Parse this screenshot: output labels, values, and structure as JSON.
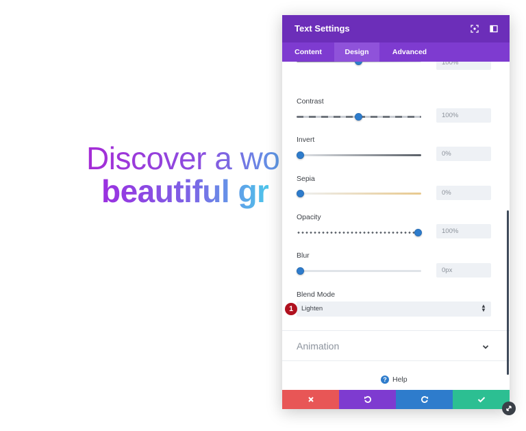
{
  "hero": {
    "line1": "Discover a wo",
    "line2": "beautiful gr"
  },
  "panel": {
    "title": "Text Settings",
    "header_icons": [
      "focus-icon",
      "sidebar-toggle-icon"
    ],
    "tabs": [
      {
        "label": "Content",
        "active": false
      },
      {
        "label": "Design",
        "active": true
      },
      {
        "label": "Advanced",
        "active": false
      }
    ],
    "fields": {
      "top_partial_value": "100%",
      "contrast": {
        "label": "Contrast",
        "value": "100%",
        "fraction": 0.5
      },
      "invert": {
        "label": "Invert",
        "value": "0%",
        "fraction": 0.0
      },
      "sepia": {
        "label": "Sepia",
        "value": "0%",
        "fraction": 0.0
      },
      "opacity": {
        "label": "Opacity",
        "value": "100%",
        "fraction": 1.0
      },
      "blur": {
        "label": "Blur",
        "value": "0px",
        "fraction": 0.0
      }
    },
    "blend_mode": {
      "label": "Blend Mode",
      "selected": "Lighten",
      "badge": "1"
    },
    "animation": {
      "label": "Animation"
    },
    "help": {
      "label": "Help"
    },
    "footer": {
      "cancel_color": "#e85656",
      "undo_color": "#7e3bd0",
      "redo_color": "#2e7ccc",
      "save_color": "#2cbf92"
    }
  },
  "colors": {
    "header": "#6c2eb9",
    "tabs": "#7e3bd0",
    "slider_thumb": "#2e7ccc"
  }
}
